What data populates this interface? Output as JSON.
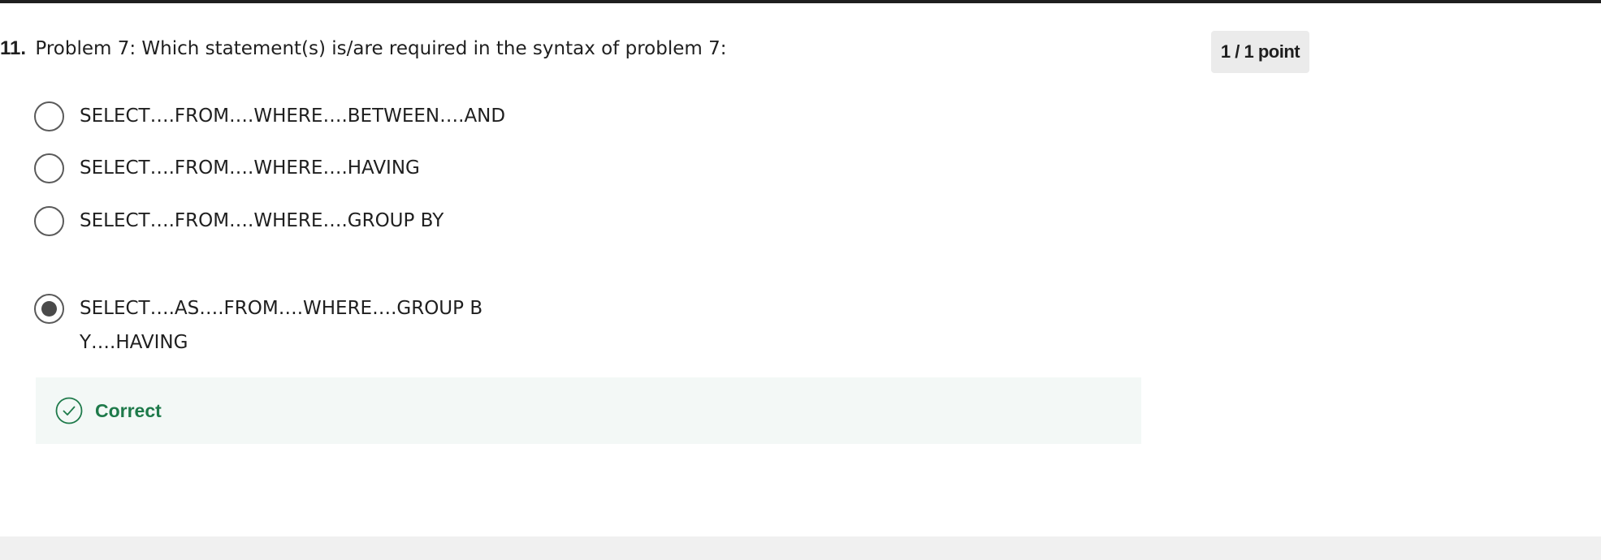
{
  "question": {
    "number": "11.",
    "text": "Problem 7: Which statement(s) is/are required in the syntax of problem 7:"
  },
  "points": {
    "label": "1 / 1 point"
  },
  "options": [
    {
      "label": "SELECT….FROM….WHERE….BETWEEN….AND",
      "selected": false
    },
    {
      "label": "SELECT….FROM….WHERE….HAVING",
      "selected": false
    },
    {
      "label": "SELECT….FROM….WHERE….GROUP BY",
      "selected": false
    },
    {
      "label": "SELECT….AS….FROM….WHERE….GROUP BY….HAVING",
      "selected": true
    }
  ],
  "feedback": {
    "icon": "check-circle-icon",
    "label": "Correct",
    "color": "#1e7a4a"
  }
}
